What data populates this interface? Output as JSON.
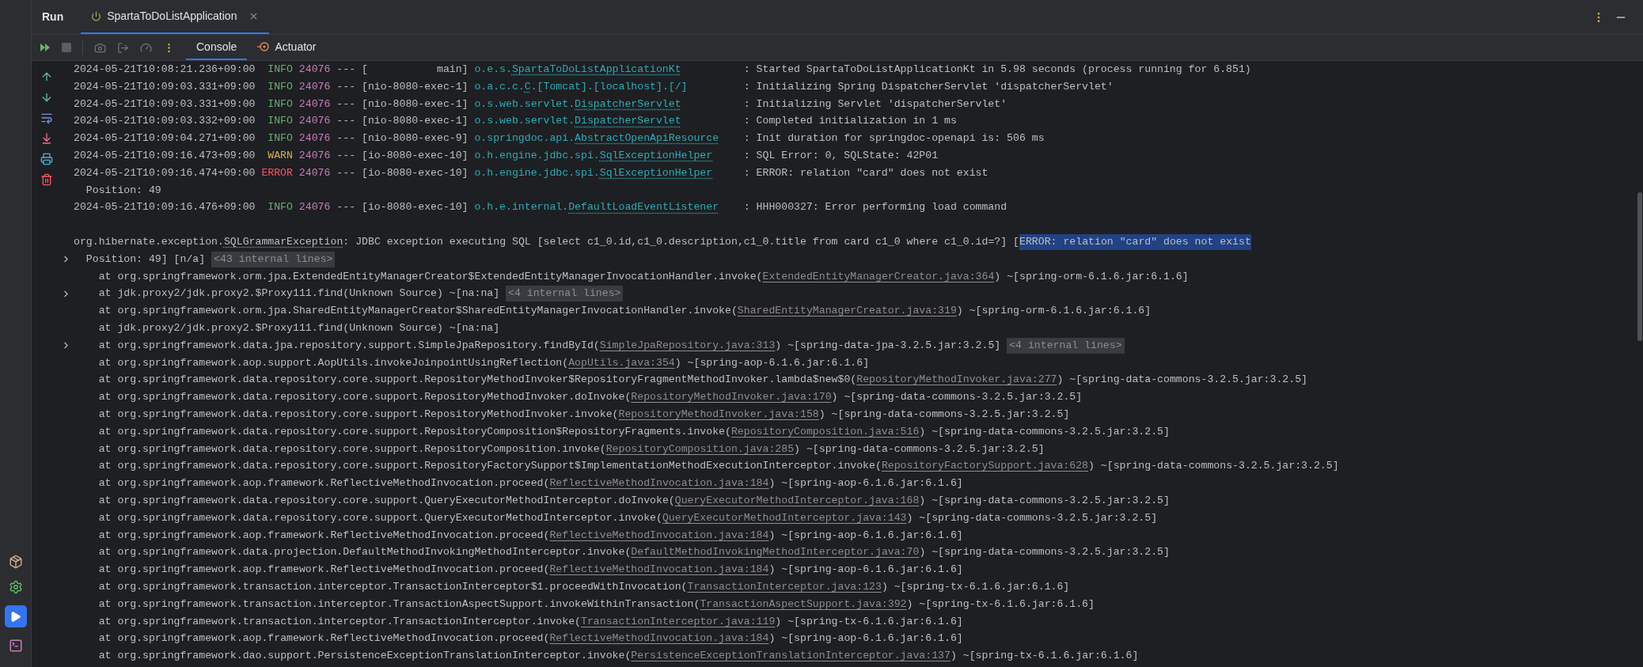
{
  "header": {
    "title": "Run",
    "tabs": [
      {
        "label": "SpartaToDoListApplication",
        "selected": true
      }
    ]
  },
  "console_tabs": [
    {
      "label": "Console",
      "selected": true,
      "kind": "console"
    },
    {
      "label": "Actuator",
      "selected": false,
      "kind": "actuator"
    }
  ],
  "lines": [
    {
      "kind": "log",
      "expandable": false,
      "time": "2024-05-21T10:08:21.236+09:00",
      "level": {
        "text": "INFO",
        "kind": "info"
      },
      "pid": "24076",
      "separator": "---",
      "thread": "[           main]",
      "logger": [
        {
          "text": "o.e.s.",
          "kind": "package"
        },
        {
          "text": "SpartaToDoListApplicationKt",
          "kind": "class"
        }
      ],
      "message": ": Started SpartaToDoListApplicationKt in 5.98 seconds (process running for 6.851)"
    },
    {
      "kind": "log",
      "expandable": false,
      "time": "2024-05-21T10:09:03.331+09:00",
      "level": {
        "text": "INFO",
        "kind": "info"
      },
      "pid": "24076",
      "separator": "---",
      "thread": "[nio-8080-exec-1]",
      "logger": [
        {
          "text": "o.a.c.c.",
          "kind": "package"
        },
        {
          "text": "C",
          "kind": "class"
        },
        {
          "text": ".[Tomcat].[localhost].[/]",
          "kind": "package"
        }
      ],
      "message": ": Initializing Spring DispatcherServlet 'dispatcherServlet'"
    },
    {
      "kind": "log",
      "expandable": false,
      "time": "2024-05-21T10:09:03.331+09:00",
      "level": {
        "text": "INFO",
        "kind": "info"
      },
      "pid": "24076",
      "separator": "---",
      "thread": "[nio-8080-exec-1]",
      "logger": [
        {
          "text": "o.s.web.servlet.",
          "kind": "package"
        },
        {
          "text": "DispatcherServlet",
          "kind": "class"
        }
      ],
      "message": ": Initializing Servlet 'dispatcherServlet'"
    },
    {
      "kind": "log",
      "expandable": false,
      "time": "2024-05-21T10:09:03.332+09:00",
      "level": {
        "text": "INFO",
        "kind": "info"
      },
      "pid": "24076",
      "separator": "---",
      "thread": "[nio-8080-exec-1]",
      "logger": [
        {
          "text": "o.s.web.servlet.",
          "kind": "package"
        },
        {
          "text": "DispatcherServlet",
          "kind": "class"
        }
      ],
      "message": ": Completed initialization in 1 ms"
    },
    {
      "kind": "log",
      "expandable": false,
      "time": "2024-05-21T10:09:04.271+09:00",
      "level": {
        "text": "INFO",
        "kind": "info"
      },
      "pid": "24076",
      "separator": "---",
      "thread": "[nio-8080-exec-9]",
      "logger": [
        {
          "text": "o.springdoc.api.",
          "kind": "package"
        },
        {
          "text": "AbstractOpenApiResource",
          "kind": "class"
        }
      ],
      "message": ": Init duration for springdoc-openapi is: 506 ms"
    },
    {
      "kind": "log",
      "expandable": false,
      "time": "2024-05-21T10:09:16.473+09:00",
      "level": {
        "text": "WARN",
        "kind": "warn"
      },
      "pid": "24076",
      "separator": "---",
      "thread": "[io-8080-exec-10]",
      "logger": [
        {
          "text": "o.h.engine.jdbc.spi.",
          "kind": "package"
        },
        {
          "text": "SqlExceptionHelper",
          "kind": "class"
        }
      ],
      "message": ": SQL Error: 0, SQLState: 42P01"
    },
    {
      "kind": "log",
      "expandable": false,
      "time": "2024-05-21T10:09:16.474+09:00",
      "level": {
        "text": "ERROR",
        "kind": "error"
      },
      "pid": "24076",
      "separator": "---",
      "thread": "[io-8080-exec-10]",
      "logger": [
        {
          "text": "o.h.engine.jdbc.spi.",
          "kind": "package"
        },
        {
          "text": "SqlExceptionHelper",
          "kind": "class"
        }
      ],
      "message": ": ERROR: relation \"card\" does not exist"
    },
    {
      "kind": "detail",
      "expandable": false,
      "segments": [
        {
          "text": "Position: 49",
          "kind": "text"
        }
      ]
    },
    {
      "kind": "log",
      "expandable": false,
      "time": "2024-05-21T10:09:16.476+09:00",
      "level": {
        "text": "INFO",
        "kind": "info"
      },
      "pid": "24076",
      "separator": "---",
      "thread": "[io-8080-exec-10]",
      "logger": [
        {
          "text": "o.h.e.internal.",
          "kind": "package"
        },
        {
          "text": "DefaultLoadEventListener",
          "kind": "class"
        }
      ],
      "message": ": HHH000327: Error performing load command"
    },
    {
      "kind": "blank",
      "expandable": false
    },
    {
      "kind": "exception",
      "expandable": false,
      "segments": [
        {
          "text": "org.hibernate.exception.",
          "kind": "text"
        },
        {
          "text": "SQLGrammarException",
          "kind": "class_link"
        },
        {
          "text": ": JDBC exception executing SQL [select c1_0.id,c1_0.description,c1_0.title from card c1_0 where c1_0.id=?] [",
          "kind": "text"
        },
        {
          "text": "ERROR: relation \"card\" does not exist",
          "kind": "selection"
        }
      ]
    },
    {
      "kind": "detail",
      "expandable": true,
      "segments": [
        {
          "text": "Position: 49] [n/a]",
          "kind": "text"
        },
        {
          "text": "<43 internal lines>",
          "kind": "folded"
        }
      ]
    },
    {
      "kind": "frame",
      "expandable": false,
      "segments": [
        {
          "text": "at org.springframework.orm.jpa.ExtendedEntityManagerCreator$ExtendedEntityManagerInvocationHandler.invoke(",
          "kind": "text"
        },
        {
          "text": "ExtendedEntityManagerCreator.java:364",
          "kind": "file_link"
        },
        {
          "text": ") ~[spring-orm-6.1.6.jar:6.1.6]",
          "kind": "text"
        }
      ]
    },
    {
      "kind": "frame",
      "expandable": true,
      "segments": [
        {
          "text": "at jdk.proxy2/jdk.proxy2.$Proxy111.find(Unknown Source) ~[na:na]",
          "kind": "text"
        },
        {
          "text": "<4 internal lines>",
          "kind": "folded"
        }
      ]
    },
    {
      "kind": "frame",
      "expandable": false,
      "segments": [
        {
          "text": "at org.springframework.orm.jpa.SharedEntityManagerCreator$SharedEntityManagerInvocationHandler.invoke(",
          "kind": "text"
        },
        {
          "text": "SharedEntityManagerCreator.java:319",
          "kind": "file_link"
        },
        {
          "text": ") ~[spring-orm-6.1.6.jar:6.1.6]",
          "kind": "text"
        }
      ]
    },
    {
      "kind": "frame",
      "expandable": false,
      "segments": [
        {
          "text": "at jdk.proxy2/jdk.proxy2.$Proxy111.find(Unknown Source) ~[na:na]",
          "kind": "text"
        }
      ]
    },
    {
      "kind": "frame",
      "expandable": true,
      "segments": [
        {
          "text": "at org.springframework.data.jpa.repository.support.SimpleJpaRepository.findById(",
          "kind": "text"
        },
        {
          "text": "SimpleJpaRepository.java:313",
          "kind": "file_link"
        },
        {
          "text": ") ~[spring-data-jpa-3.2.5.jar:3.2.5]",
          "kind": "text"
        },
        {
          "text": "<4 internal lines>",
          "kind": "folded"
        }
      ]
    },
    {
      "kind": "frame",
      "expandable": false,
      "segments": [
        {
          "text": "at org.springframework.aop.support.AopUtils.invokeJoinpointUsingReflection(",
          "kind": "text"
        },
        {
          "text": "AopUtils.java:354",
          "kind": "file_link"
        },
        {
          "text": ") ~[spring-aop-6.1.6.jar:6.1.6]",
          "kind": "text"
        }
      ]
    },
    {
      "kind": "frame",
      "expandable": false,
      "segments": [
        {
          "text": "at org.springframework.data.repository.core.support.RepositoryMethodInvoker$RepositoryFragmentMethodInvoker.lambda$new$0(",
          "kind": "text"
        },
        {
          "text": "RepositoryMethodInvoker.java:277",
          "kind": "file_link"
        },
        {
          "text": ") ~[spring-data-commons-3.2.5.jar:3.2.5]",
          "kind": "text"
        }
      ]
    },
    {
      "kind": "frame",
      "expandable": false,
      "segments": [
        {
          "text": "at org.springframework.data.repository.core.support.RepositoryMethodInvoker.doInvoke(",
          "kind": "text"
        },
        {
          "text": "RepositoryMethodInvoker.java:170",
          "kind": "file_link"
        },
        {
          "text": ") ~[spring-data-commons-3.2.5.jar:3.2.5]",
          "kind": "text"
        }
      ]
    },
    {
      "kind": "frame",
      "expandable": false,
      "segments": [
        {
          "text": "at org.springframework.data.repository.core.support.RepositoryMethodInvoker.invoke(",
          "kind": "text"
        },
        {
          "text": "RepositoryMethodInvoker.java:158",
          "kind": "file_link"
        },
        {
          "text": ") ~[spring-data-commons-3.2.5.jar:3.2.5]",
          "kind": "text"
        }
      ]
    },
    {
      "kind": "frame",
      "expandable": false,
      "segments": [
        {
          "text": "at org.springframework.data.repository.core.support.RepositoryComposition$RepositoryFragments.invoke(",
          "kind": "text"
        },
        {
          "text": "RepositoryComposition.java:516",
          "kind": "file_link"
        },
        {
          "text": ") ~[spring-data-commons-3.2.5.jar:3.2.5]",
          "kind": "text"
        }
      ]
    },
    {
      "kind": "frame",
      "expandable": false,
      "segments": [
        {
          "text": "at org.springframework.data.repository.core.support.RepositoryComposition.invoke(",
          "kind": "text"
        },
        {
          "text": "RepositoryComposition.java:285",
          "kind": "file_link"
        },
        {
          "text": ") ~[spring-data-commons-3.2.5.jar:3.2.5]",
          "kind": "text"
        }
      ]
    },
    {
      "kind": "frame",
      "expandable": false,
      "segments": [
        {
          "text": "at org.springframework.data.repository.core.support.RepositoryFactorySupport$ImplementationMethodExecutionInterceptor.invoke(",
          "kind": "text"
        },
        {
          "text": "RepositoryFactorySupport.java:628",
          "kind": "file_link"
        },
        {
          "text": ") ~[spring-data-commons-3.2.5.jar:3.2.5]",
          "kind": "text"
        }
      ]
    },
    {
      "kind": "frame",
      "expandable": false,
      "segments": [
        {
          "text": "at org.springframework.aop.framework.ReflectiveMethodInvocation.proceed(",
          "kind": "text"
        },
        {
          "text": "ReflectiveMethodInvocation.java:184",
          "kind": "file_link"
        },
        {
          "text": ") ~[spring-aop-6.1.6.jar:6.1.6]",
          "kind": "text"
        }
      ]
    },
    {
      "kind": "frame",
      "expandable": false,
      "segments": [
        {
          "text": "at org.springframework.data.repository.core.support.QueryExecutorMethodInterceptor.doInvoke(",
          "kind": "text"
        },
        {
          "text": "QueryExecutorMethodInterceptor.java:168",
          "kind": "file_link"
        },
        {
          "text": ") ~[spring-data-commons-3.2.5.jar:3.2.5]",
          "kind": "text"
        }
      ]
    },
    {
      "kind": "frame",
      "expandable": false,
      "segments": [
        {
          "text": "at org.springframework.data.repository.core.support.QueryExecutorMethodInterceptor.invoke(",
          "kind": "text"
        },
        {
          "text": "QueryExecutorMethodInterceptor.java:143",
          "kind": "file_link"
        },
        {
          "text": ") ~[spring-data-commons-3.2.5.jar:3.2.5]",
          "kind": "text"
        }
      ]
    },
    {
      "kind": "frame",
      "expandable": false,
      "segments": [
        {
          "text": "at org.springframework.aop.framework.ReflectiveMethodInvocation.proceed(",
          "kind": "text"
        },
        {
          "text": "ReflectiveMethodInvocation.java:184",
          "kind": "file_link"
        },
        {
          "text": ") ~[spring-aop-6.1.6.jar:6.1.6]",
          "kind": "text"
        }
      ]
    },
    {
      "kind": "frame",
      "expandable": false,
      "segments": [
        {
          "text": "at org.springframework.data.projection.DefaultMethodInvokingMethodInterceptor.invoke(",
          "kind": "text"
        },
        {
          "text": "DefaultMethodInvokingMethodInterceptor.java:70",
          "kind": "file_link"
        },
        {
          "text": ") ~[spring-data-commons-3.2.5.jar:3.2.5]",
          "kind": "text"
        }
      ]
    },
    {
      "kind": "frame",
      "expandable": false,
      "segments": [
        {
          "text": "at org.springframework.aop.framework.ReflectiveMethodInvocation.proceed(",
          "kind": "text"
        },
        {
          "text": "ReflectiveMethodInvocation.java:184",
          "kind": "file_link"
        },
        {
          "text": ") ~[spring-aop-6.1.6.jar:6.1.6]",
          "kind": "text"
        }
      ]
    },
    {
      "kind": "frame",
      "expandable": false,
      "segments": [
        {
          "text": "at org.springframework.transaction.interceptor.TransactionInterceptor$1.proceedWithInvocation(",
          "kind": "text"
        },
        {
          "text": "TransactionInterceptor.java:123",
          "kind": "file_link"
        },
        {
          "text": ") ~[spring-tx-6.1.6.jar:6.1.6]",
          "kind": "text"
        }
      ]
    },
    {
      "kind": "frame",
      "expandable": false,
      "segments": [
        {
          "text": "at org.springframework.transaction.interceptor.TransactionAspectSupport.invokeWithinTransaction(",
          "kind": "text"
        },
        {
          "text": "TransactionAspectSupport.java:392",
          "kind": "file_link"
        },
        {
          "text": ") ~[spring-tx-6.1.6.jar:6.1.6]",
          "kind": "text"
        }
      ]
    },
    {
      "kind": "frame",
      "expandable": false,
      "segments": [
        {
          "text": "at org.springframework.transaction.interceptor.TransactionInterceptor.invoke(",
          "kind": "text"
        },
        {
          "text": "TransactionInterceptor.java:119",
          "kind": "file_link"
        },
        {
          "text": ") ~[spring-tx-6.1.6.jar:6.1.6]",
          "kind": "text"
        }
      ]
    },
    {
      "kind": "frame",
      "expandable": false,
      "segments": [
        {
          "text": "at org.springframework.aop.framework.ReflectiveMethodInvocation.proceed(",
          "kind": "text"
        },
        {
          "text": "ReflectiveMethodInvocation.java:184",
          "kind": "file_link"
        },
        {
          "text": ") ~[spring-aop-6.1.6.jar:6.1.6]",
          "kind": "text"
        }
      ]
    },
    {
      "kind": "frame",
      "expandable": false,
      "segments": [
        {
          "text": "at org.springframework.dao.support.PersistenceExceptionTranslationInterceptor.invoke(",
          "kind": "text"
        },
        {
          "text": "PersistenceExceptionTranslationInterceptor.java:137",
          "kind": "file_link"
        },
        {
          "text": ") ~[spring-tx-6.1.6.jar:6.1.6]",
          "kind": "text"
        }
      ]
    }
  ]
}
